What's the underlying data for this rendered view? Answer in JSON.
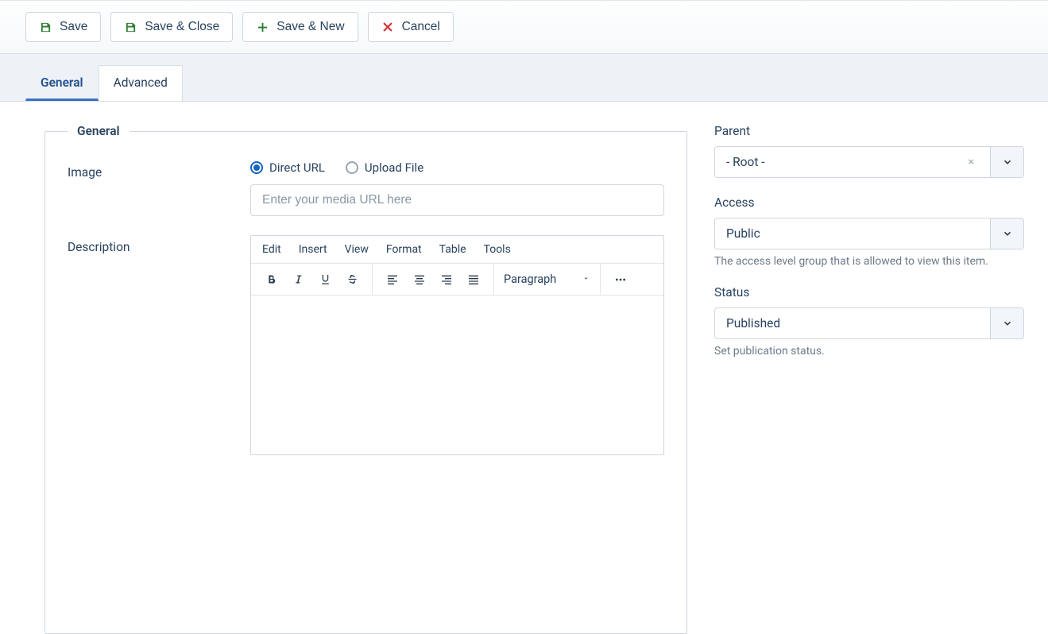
{
  "toolbar": {
    "save": "Save",
    "save_close": "Save & Close",
    "save_new": "Save & New",
    "cancel": "Cancel"
  },
  "tabs": {
    "general": "General",
    "advanced": "Advanced"
  },
  "fieldset": {
    "legend": "General"
  },
  "image": {
    "label": "Image",
    "option_direct": "Direct URL",
    "option_upload": "Upload File",
    "url_placeholder": "Enter your media URL here"
  },
  "description": {
    "label": "Description"
  },
  "editor": {
    "menu": {
      "edit": "Edit",
      "insert": "Insert",
      "view": "View",
      "format": "Format",
      "table": "Table",
      "tools": "Tools"
    },
    "para_label": "Paragraph"
  },
  "side": {
    "parent": {
      "label": "Parent",
      "value": "- Root -"
    },
    "access": {
      "label": "Access",
      "value": "Public",
      "help": "The access level group that is allowed to view this item."
    },
    "status": {
      "label": "Status",
      "value": "Published",
      "help": "Set publication status."
    }
  }
}
